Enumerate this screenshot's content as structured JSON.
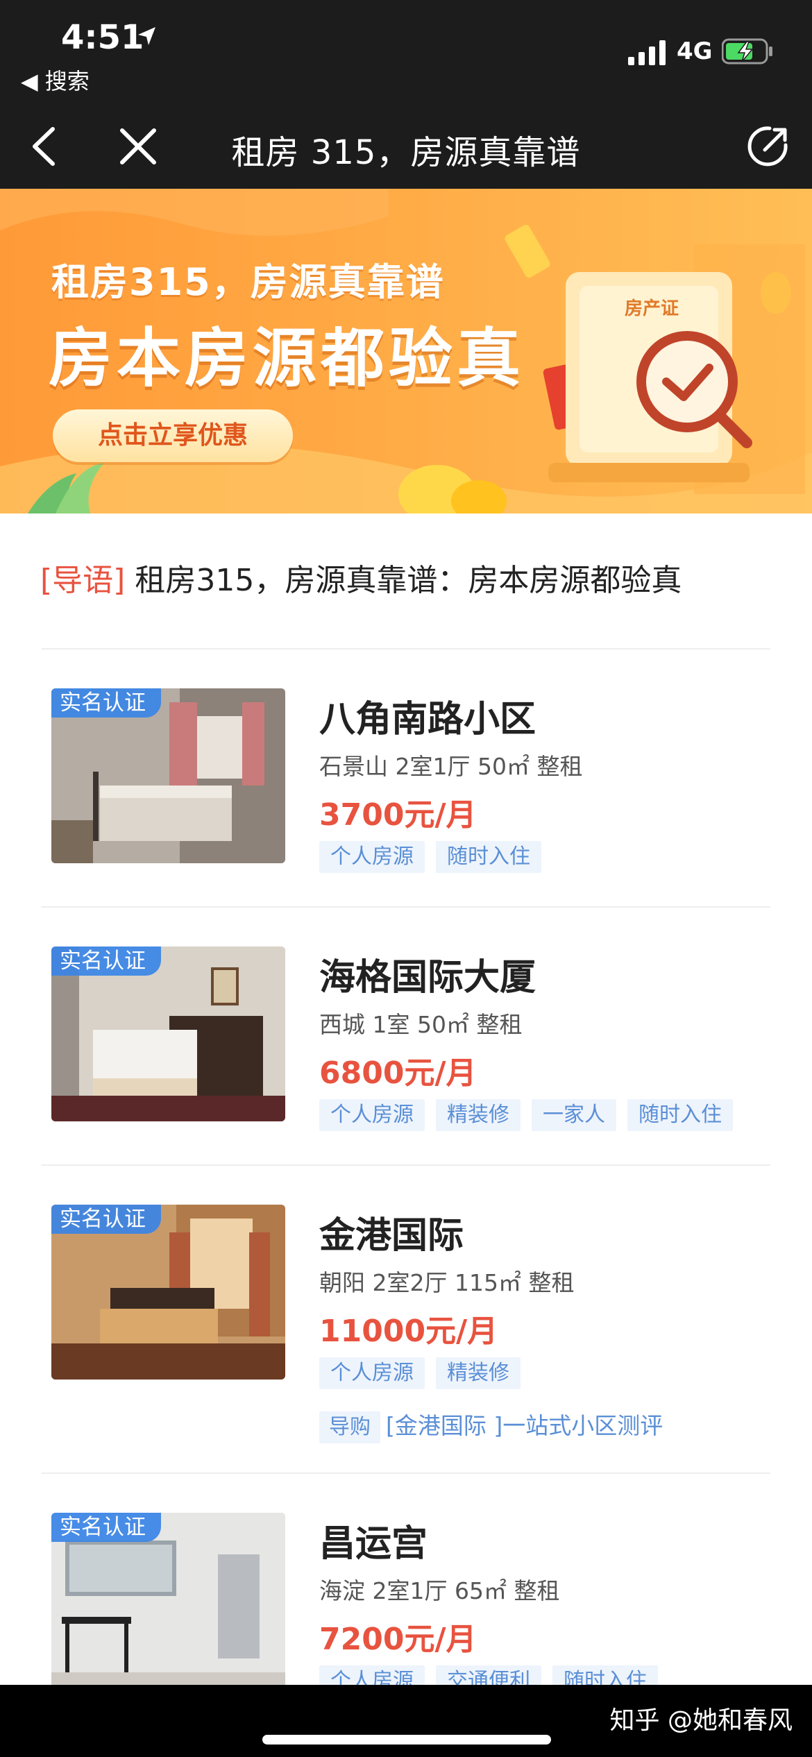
{
  "status_bar": {
    "time": "4:51",
    "back_app": "◀ 搜索",
    "network": "4G"
  },
  "nav": {
    "title": "租房 315，房源真靠谱"
  },
  "banner": {
    "line1": "租房315，房源真靠谱",
    "line2": "房本房源都验真",
    "button": "点击立享优惠",
    "cert_label": "房产证"
  },
  "lead": {
    "tag": "[导语]",
    "text": "租房315，房源真靠谱：房本房源都验真"
  },
  "listings": [
    {
      "badge": "实名认证",
      "name": "八角南路小区",
      "meta": "石景山  2室1厅  50㎡  整租",
      "price": "3700元/月",
      "tags": [
        "个人房源",
        "随时入住"
      ]
    },
    {
      "badge": "实名认证",
      "name": "海格国际大厦",
      "meta": "西城  1室  50㎡  整租",
      "price": "6800元/月",
      "tags": [
        "个人房源",
        "精装修",
        "一家人",
        "随时入住"
      ]
    },
    {
      "badge": "实名认证",
      "name": "金港国际",
      "meta": "朝阳  2室2厅  115㎡  整租",
      "price": "11000元/月",
      "tags": [
        "个人房源",
        "精装修"
      ],
      "guide": {
        "tag": "导购",
        "text": "[金港国际  ]一站式小区测评"
      }
    },
    {
      "badge": "实名认证",
      "name": "昌运宫",
      "meta": "海淀  2室1厅  65㎡  整租",
      "price": "7200元/月",
      "tags": [
        "个人房源",
        "交通便利",
        "随时入住"
      ]
    }
  ],
  "watermark": "知乎 @她和春风",
  "colors": {
    "accent_red": "#e8533f",
    "badge_blue": "#3a84e6",
    "tag_blue": "#5a8fd6",
    "bar_dark": "#1c1c1c"
  }
}
